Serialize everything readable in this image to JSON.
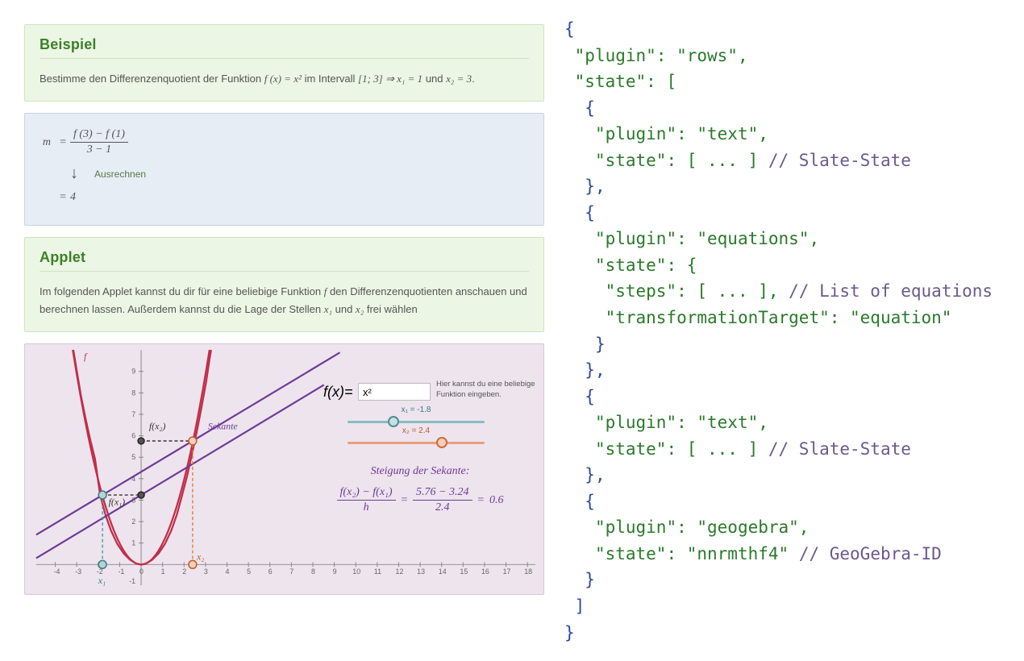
{
  "example": {
    "heading": "Beispiel",
    "text_pre": "Bestimme den Differenzenquotient der Funktion ",
    "fx": "f (x) = x²",
    "text_mid": " im Intervall ",
    "interval": "[1; 3] ⇒ x₁ = 1",
    "text_post": " und ",
    "x2": "x₂ = 3",
    "period": "."
  },
  "equations": {
    "lhs": "m",
    "eq": "=",
    "num": "f (3) − f (1)",
    "den": "3 − 1",
    "arrow": "↓",
    "hint": "Ausrechnen",
    "result": "4"
  },
  "applet": {
    "heading": "Applet",
    "desc_1": "Im folgenden Applet kannst du dir für eine beliebige Funktion ",
    "desc_f": "f",
    "desc_2": "  den Differenzenquotienten anschauen und berechnen lassen. Außerdem kannst du die Lage der Stellen ",
    "desc_x1": "x₁",
    "desc_and": " und ",
    "desc_x2": "x₂",
    "desc_3": " frei wählen",
    "y_label": "f",
    "fx_label": "f(x)=",
    "input_value": "x²",
    "hint": "Hier kannst du eine beliebige Funktion eingeben.",
    "sekante": "Sekante",
    "fx1_label": "f(x₁)",
    "fx2_label": "f(x₂)",
    "x1_axis": "x₁",
    "x2_axis": "x₂",
    "slider1_label": "x₁ = -1.8",
    "slider2_label": "x₂ = 2.4",
    "slope_title": "Steigung der Sekante:",
    "slope_num": "f(x₂) − f(x₁)",
    "slope_den": "h",
    "slope_vnum": "5.76 − 3.24",
    "slope_vden": "2.4",
    "slope_res": "0.6"
  },
  "json_code": {
    "plugin_root": "\"plugin\": \"rows\",",
    "state_open": "\"state\": [",
    "p1_plugin": "\"plugin\": \"text\",",
    "p1_state": "\"state\": [ ... ] ",
    "p1_comment": "// Slate-State",
    "p2_plugin": "\"plugin\": \"equations\",",
    "p2_state_open": "\"state\": {",
    "p2_steps": "\"steps\": [ ... ], ",
    "p2_steps_comment": "// List of equations",
    "p2_target": "\"transformationTarget\": \"equation\"",
    "p3_plugin": "\"plugin\": \"text\",",
    "p3_state": "\"state\": [ ... ] ",
    "p3_comment": "// Slate-State",
    "p4_plugin": "\"plugin\": \"geogebra\",",
    "p4_state": "\"state\": \"nnrmthf4\" ",
    "p4_comment": "// GeoGebra-ID"
  }
}
